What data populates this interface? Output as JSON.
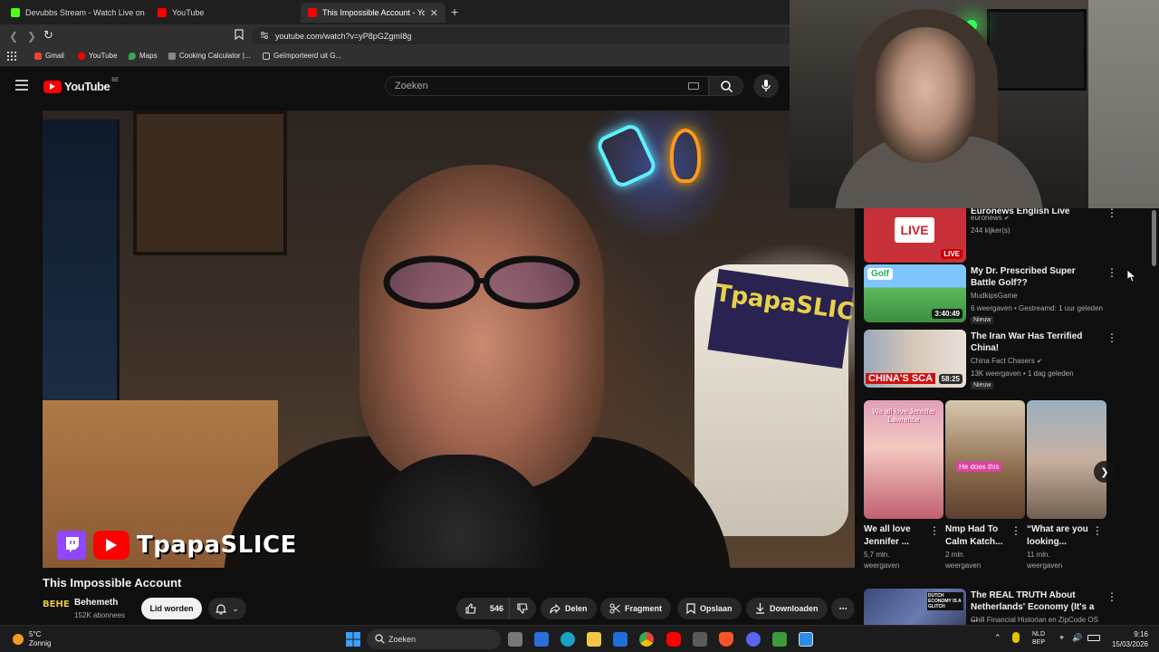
{
  "browser": {
    "tabs": [
      {
        "label": "Devubbs Stream - Watch Live on",
        "icon": "kick-icon"
      },
      {
        "label": "YouTube",
        "icon": "youtube-icon"
      },
      {
        "label": "This Impossible Account - Yo",
        "icon": "youtube-icon",
        "active": true
      }
    ],
    "new_tab": "+",
    "url": "youtube.com/watch?v=yP8pGZgmI8g",
    "bookmarks": [
      "Gmail",
      "YouTube",
      "Maps",
      "Cooking Calculator |...",
      "Geïmporteerd uit G..."
    ]
  },
  "youtube": {
    "logo_text": "YouTube",
    "region": "BE",
    "search_placeholder": "Zoeken"
  },
  "video": {
    "overlay_channel": "TpapaSLICE",
    "banner_text": "TpapaSLICE",
    "title": "This Impossible Account",
    "channel_avatar_text": "BEHE",
    "channel_name": "Behemeth",
    "subscribers": "152K abonnees",
    "join_label": "Lid worden",
    "likes": "546",
    "share_label": "Delen",
    "clip_label": "Fragment",
    "save_label": "Opslaan",
    "download_label": "Downloaden"
  },
  "recommendations": [
    {
      "title": "Euronews English Live",
      "thumb_text": "LIVE",
      "badge": "LIVE",
      "channel": "euronews",
      "verified": true,
      "meta": "244 kijker(s)"
    },
    {
      "title": "My Dr. Prescribed Super Battle Golf??",
      "thumb_text": "Golf",
      "duration": "3:40:49",
      "channel": "MudkipsGame",
      "verified": false,
      "meta": "6 weergaven • Gestreamd: 1 uur geleden",
      "tag": "Nieuw"
    },
    {
      "title": "The Iran War Has Terrified China!",
      "thumb_text": "CHINA'S SCA",
      "duration": "58:25",
      "channel": "China Fact Chasers",
      "verified": true,
      "meta": "13K weergaven • 1 dag geleden",
      "tag": "Nieuw"
    },
    {
      "title": "The REAL TRUTH About Netherlands' Economy (It's a ...",
      "thumb_text": "DUTCH ECONOMY IS A GLITCH",
      "channel": "Chill Financial Historian en ZipCode OS",
      "verified": false,
      "meta": ""
    }
  ],
  "shorts": [
    {
      "title": "We all love Jennifer ...",
      "views": "5,7 mln. weergaven",
      "thumb_text": "We all love Jennifer Lawrence"
    },
    {
      "title": "Nmp Had To Calm Katch...",
      "views": "2 mln. weergaven",
      "thumb_text": "He does this"
    },
    {
      "title": "“What are you looking...",
      "views": "11 mln. weergaven",
      "thumb_text": ""
    }
  ],
  "taskbar": {
    "temperature": "5°C",
    "weather": "Zonnig",
    "search_label": "Zoeken",
    "lang": "NLD",
    "layout": "BEP",
    "time": "9:16",
    "date": "15/03/2026"
  },
  "colors": {
    "accent": "#ff0000",
    "twitch": "#9146ff",
    "background": "#0f0f0f"
  }
}
